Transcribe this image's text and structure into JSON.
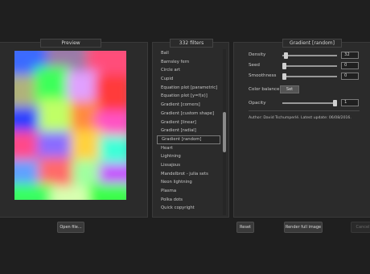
{
  "preview": {
    "title": "Preview"
  },
  "filters": {
    "title": "332 filters",
    "items": [
      "Ball",
      "Barnsley fern",
      "Circle art",
      "Cupid",
      "Equation plot [parametric]",
      "Equation plot [y=f(x)]",
      "Gradient [corners]",
      "Gradient [custom shape]",
      "Gradient [linear]",
      "Gradient [radial]",
      "Gradient [random]",
      "Heart",
      "Lightning",
      "Lissajous",
      "Mandelbrot - julia sets",
      "Neon lightning",
      "Plasma",
      "Polka dots",
      "Quick copyright"
    ],
    "selected": "Gradient [random]",
    "scroll_position": 0.5
  },
  "params": {
    "title": "Gradient [random]",
    "density": {
      "label": "Density",
      "value": "32",
      "level": 0.03
    },
    "seed": {
      "label": "Seed",
      "value": "0",
      "level": 0.0
    },
    "smoothness": {
      "label": "Smoothness",
      "value": "0",
      "level": 0.0
    },
    "color_balance": {
      "label": "Color balance",
      "button": "Set"
    },
    "opacity": {
      "label": "Opacity",
      "value": "1",
      "level": 1.0
    },
    "author": "Author: David Tschumperlé. Latest update: 06/08/2016."
  },
  "buttons": {
    "open_file": "Open file...",
    "reset": "Reset",
    "render": "Render full image",
    "cancel": "Cancel"
  },
  "colors": {
    "background": "#1f1f1f",
    "panel": "#2b2b2b",
    "accent": "#8a8a8a"
  }
}
